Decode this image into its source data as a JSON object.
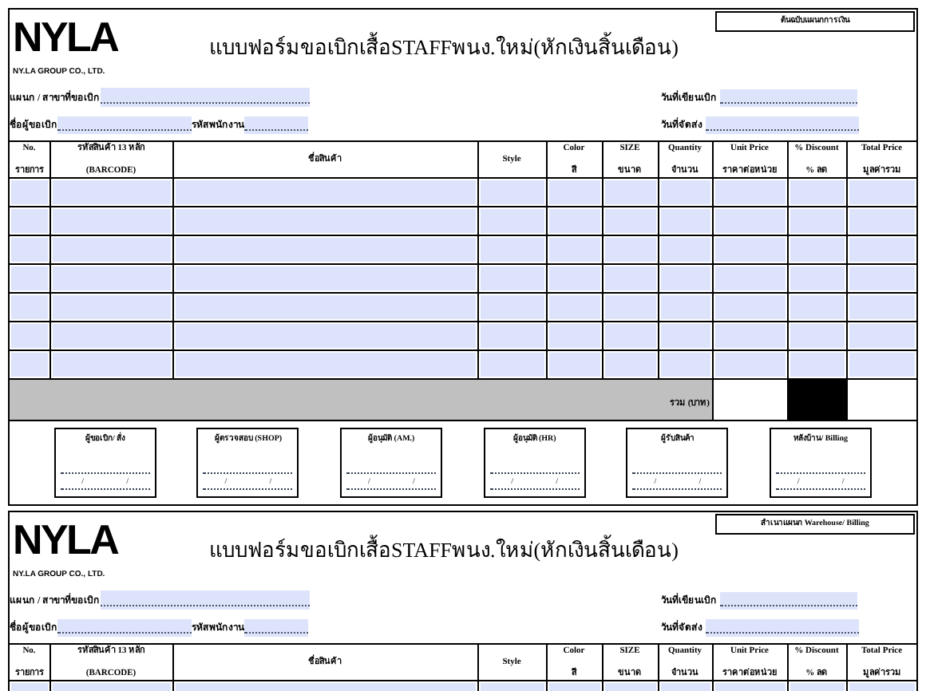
{
  "forms": [
    {
      "copy_label": "ต้นฉบับแผนกการเงิน",
      "logo": {
        "left": "NY",
        "right": "LA"
      },
      "company": "NY.LA GROUP CO., LTD.",
      "title": "แบบฟอร์มขอเบิกเสื้อSTAFFพนง.ใหม่(หักเงินสิ้นเดือน)",
      "fields": {
        "department": "แผนก / สาขาที่ขอเบิก",
        "requester": "ชื่อผู้ขอเบิก",
        "employee_id": "รหัสพนักงาน",
        "request_date": "วันที่เขียนเบิก",
        "delivery_date": "วันที่จัดส่ง"
      },
      "columns": [
        [
          "No.",
          "รายการ"
        ],
        [
          "รหัสสินค้า 13 หลัก",
          "(BARCODE)"
        ],
        [
          "ชื่อสินค้า"
        ],
        [
          "Style"
        ],
        [
          "Color",
          "สี"
        ],
        [
          "SIZE",
          "ขนาด"
        ],
        [
          "Quantity",
          "จำนวน"
        ],
        [
          "Unit Price",
          "ราคาต่อหน่วย"
        ],
        [
          "% Discount",
          "% ลด"
        ],
        [
          "Total Price",
          "มูลค่ารวม"
        ]
      ],
      "total_label": "รวม (บาท)",
      "signatures": [
        {
          "title": "ผู้ขอเบิก/ สั่ง",
          "date_separator": "/"
        },
        {
          "title": "ผู้ตรวจสอบ (SHOP)",
          "date_separator": "/"
        },
        {
          "title": "ผู้อนุมัติ (AM.)",
          "date_separator": "/"
        },
        {
          "title": "ผู้อนุมัติ (HR)",
          "date_separator": "/"
        },
        {
          "title": "ผู้รับสินค้า",
          "date_separator": "/"
        },
        {
          "title": "หลังบ้าน/ Billing",
          "date_separator": "/"
        }
      ]
    },
    {
      "copy_label": "สำเนาแผนก Warehouse/ Billing",
      "logo": {
        "left": "NY",
        "right": "LA"
      },
      "company": "NY.LA GROUP CO., LTD.",
      "title": "แบบฟอร์มขอเบิกเสื้อSTAFFพนง.ใหม่(หักเงินสิ้นเดือน)",
      "fields": {
        "department": "แผนก / สาขาที่ขอเบิก",
        "requester": "ชื่อผู้ขอเบิก",
        "employee_id": "รหัสพนักงาน",
        "request_date": "วันที่เขียนเบิก",
        "delivery_date": "วันที่จัดส่ง"
      },
      "columns": [
        [
          "No.",
          "รายการ"
        ],
        [
          "รหัสสินค้า 13 หลัก",
          "(BARCODE)"
        ],
        [
          "ชื่อสินค้า"
        ],
        [
          "Style"
        ],
        [
          "Color",
          "สี"
        ],
        [
          "SIZE",
          "ขนาด"
        ],
        [
          "Quantity",
          "จำนวน"
        ],
        [
          "Unit Price",
          "ราคาต่อหน่วย"
        ],
        [
          "% Discount",
          "% ลด"
        ],
        [
          "Total Price",
          "มูลค่ารวม"
        ]
      ]
    }
  ]
}
